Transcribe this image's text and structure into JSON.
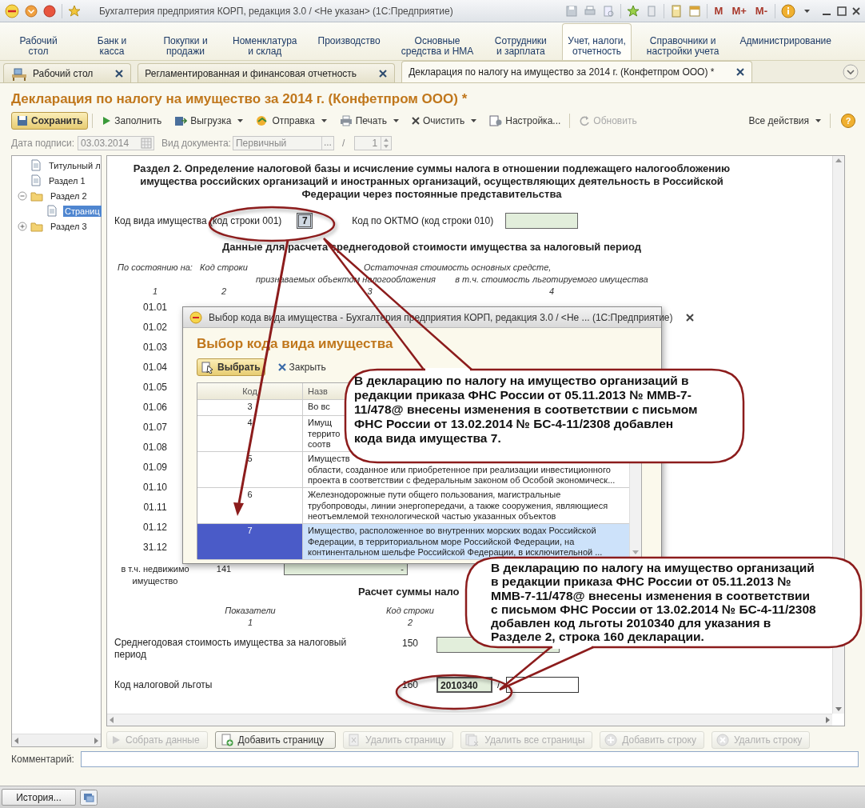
{
  "window": {
    "title": "Бухгалтерия предприятия КОРП, редакция 3.0 / <Не указан>  (1С:Предприятие)",
    "memory_buttons": [
      "M",
      "M+",
      "M-"
    ]
  },
  "sections": [
    {
      "label": "Рабочий\nстол",
      "selected": false
    },
    {
      "label": "Банк и\nкасса",
      "selected": false
    },
    {
      "label": "Покупки и\nпродажи",
      "selected": false
    },
    {
      "label": "Номенклатура\nи склад",
      "selected": false
    },
    {
      "label": "Производство",
      "selected": false
    },
    {
      "label": "Основные\nсредства и НМА",
      "selected": false
    },
    {
      "label": "Сотрудники\nи зарплата",
      "selected": false
    },
    {
      "label": "Учет, налоги,\nотчетность",
      "selected": true
    },
    {
      "label": "Справочники и\nнастройки учета",
      "selected": false
    },
    {
      "label": "Администрирование",
      "selected": false
    }
  ],
  "open_tabs": [
    {
      "label": "Рабочий стол",
      "selected": false
    },
    {
      "label": "Регламентированная и финансовая отчетность",
      "selected": false
    },
    {
      "label": "Декларация по налогу на имущество за 2014 г. (Конфетпром ООО) *",
      "selected": true
    }
  ],
  "form": {
    "title": "Декларация по налогу на имущество за 2014 г. (Конфетпром ООО) *",
    "toolbar": [
      {
        "label": "Сохранить",
        "kind": "primary"
      },
      {
        "label": "Заполнить",
        "kind": "plain"
      },
      {
        "label": "Выгрузка",
        "kind": "menu"
      },
      {
        "label": "Отправка",
        "kind": "menu"
      },
      {
        "label": "Печать",
        "kind": "menu"
      },
      {
        "label": "Очистить",
        "kind": "menu"
      },
      {
        "label": "Настройка...",
        "kind": "plain"
      },
      {
        "label": "Обновить",
        "kind": "disabled"
      }
    ],
    "all_actions": "Все действия",
    "help": "?",
    "signature_date": {
      "label": "Дата подписи:",
      "value": "03.03.2014",
      "disabled": true
    },
    "doc_type": {
      "label": "Вид документа:",
      "value": "Первичный",
      "button": "...",
      "disabled": true
    },
    "separator": "/",
    "correction": {
      "value": "1",
      "disabled": true
    }
  },
  "tree": [
    {
      "label": "Титульный л",
      "kind": "page",
      "selected": false
    },
    {
      "label": "Раздел 1",
      "kind": "page",
      "selected": false
    },
    {
      "label": "Раздел 2",
      "kind": "folder",
      "expanded": true,
      "selected": false,
      "children": [
        {
          "label": "Страниц",
          "kind": "page",
          "selected": true
        }
      ]
    },
    {
      "label": "Раздел 3",
      "kind": "folder",
      "expanded": false,
      "selected": false
    }
  ],
  "document": {
    "heading": "Раздел 2. Определение налоговой базы и исчисление суммы налога в отношении подлежащего налогообложению\nимущества российских организаций и иностранных организаций, осуществляющих деятельность в Российской\nФедерации через постоянные представительства",
    "property_code": {
      "label": "Код вида имущества (код строки 001)",
      "value": "7"
    },
    "oktmo": {
      "label": "Код по ОКТМО (код строки 010)"
    },
    "average_title": "Данные для расчета среднегодовой стоимости имущества за налоговый период",
    "group_header": "Остаточная стоимость основных средсте,",
    "columns": [
      {
        "label": "По состоянию на:",
        "number": "1"
      },
      {
        "label": "Код строки",
        "number": "2"
      },
      {
        "label": "признаваемых объектом налогообложения",
        "number": "3"
      },
      {
        "label": "в т.ч. стоимость льготируемого имущества",
        "number": "4"
      }
    ],
    "dates": [
      "01.01",
      "01.02",
      "01.03",
      "01.04",
      "01.05",
      "01.06",
      "01.07",
      "01.08",
      "01.09",
      "01.10",
      "01.11",
      "01.12",
      "31.12"
    ],
    "realty": {
      "label": "в т.ч. недвижимо\nимущество",
      "code": "141",
      "value": "-"
    },
    "calc_title": "Расчет суммы нало",
    "calc_columns": [
      {
        "label": "Показатели",
        "number": "1"
      },
      {
        "label": "Код строки",
        "number": "2"
      }
    ],
    "rows": [
      {
        "label": "Среднегодовая стоимость имущества за налоговый\nпериод",
        "code": "150"
      },
      {
        "label": "Код налоговой льготы",
        "code": "160",
        "value": "2010340",
        "separator": "/"
      }
    ]
  },
  "dialog": {
    "title": "Выбор кода вида имущества - Бухгалтерия предприятия КОРП, редакция 3.0 / <Не ...  (1С:Предприятие)",
    "heading": "Выбор кода вида имущества",
    "buttons": [
      {
        "label": "Выбрать",
        "kind": "primary"
      },
      {
        "label": "Закрыть",
        "kind": "close"
      }
    ],
    "columns": [
      "Код",
      "Назв"
    ],
    "rows": [
      {
        "code": "3",
        "lines": [
          "Во вс"
        ],
        "selected": false
      },
      {
        "code": "4",
        "lines": [
          "Имущ",
          "террито",
          "соотв"
        ],
        "selected": false
      },
      {
        "code": "5",
        "lines": [
          "Имуществ",
          "области, созданное или приобретенное при реализации инвестиционного",
          "проекта в соответствии с федеральным законом об Особой экономическ..."
        ],
        "selected": false
      },
      {
        "code": "6",
        "lines": [
          "Железнодорожные пути общего пользования, магистральные",
          "трубопроводы, линии энергопередачи, а также сооружения, являющиеся",
          "неотъемлемой технологической частью указанных объектов"
        ],
        "selected": false
      },
      {
        "code": "7",
        "lines": [
          "Имущество, расположенное во внутренних морских водах Российской",
          "Федерации, в территориальном море Российской Федерации, на",
          "континентальном шельфе Российской Федерации, в исключительной ..."
        ],
        "selected": true
      }
    ]
  },
  "bottom_buttons": [
    {
      "label": "Собрать данные",
      "disabled": true
    },
    {
      "label": "Добавить страницу",
      "disabled": false
    },
    {
      "label": "Удалить страницу",
      "disabled": true
    },
    {
      "label": "Удалить все страницы",
      "disabled": true
    },
    {
      "label": "Добавить строку",
      "disabled": true
    },
    {
      "label": "Удалить строку",
      "disabled": true
    }
  ],
  "comment": {
    "label": "Комментарий:"
  },
  "status_bar": {
    "history": "История..."
  },
  "annotations": [
    {
      "text": "В декларацию по налогу на имущество организаций в\nредакции приказа ФНС России от 05.11.2013 № ММВ-7-\n11/478@ внесены изменения в соответствии с письмом\nФНС России от 13.02.2014 № БС-4-11/2308 добавлен\nкода вида имущества 7."
    },
    {
      "text": "В декларацию по налогу на имущество организаций\nв редакции приказа ФНС России от 05.11.2013 №\nММВ-7-11/478@ внесены изменения в соответствии\nс письмом ФНС России от 13.02.2014 № БС-4-11/2308\nдобавлен код льготы 2010340 для указания в\nРазделе 2, строка 160 декларации."
    }
  ]
}
